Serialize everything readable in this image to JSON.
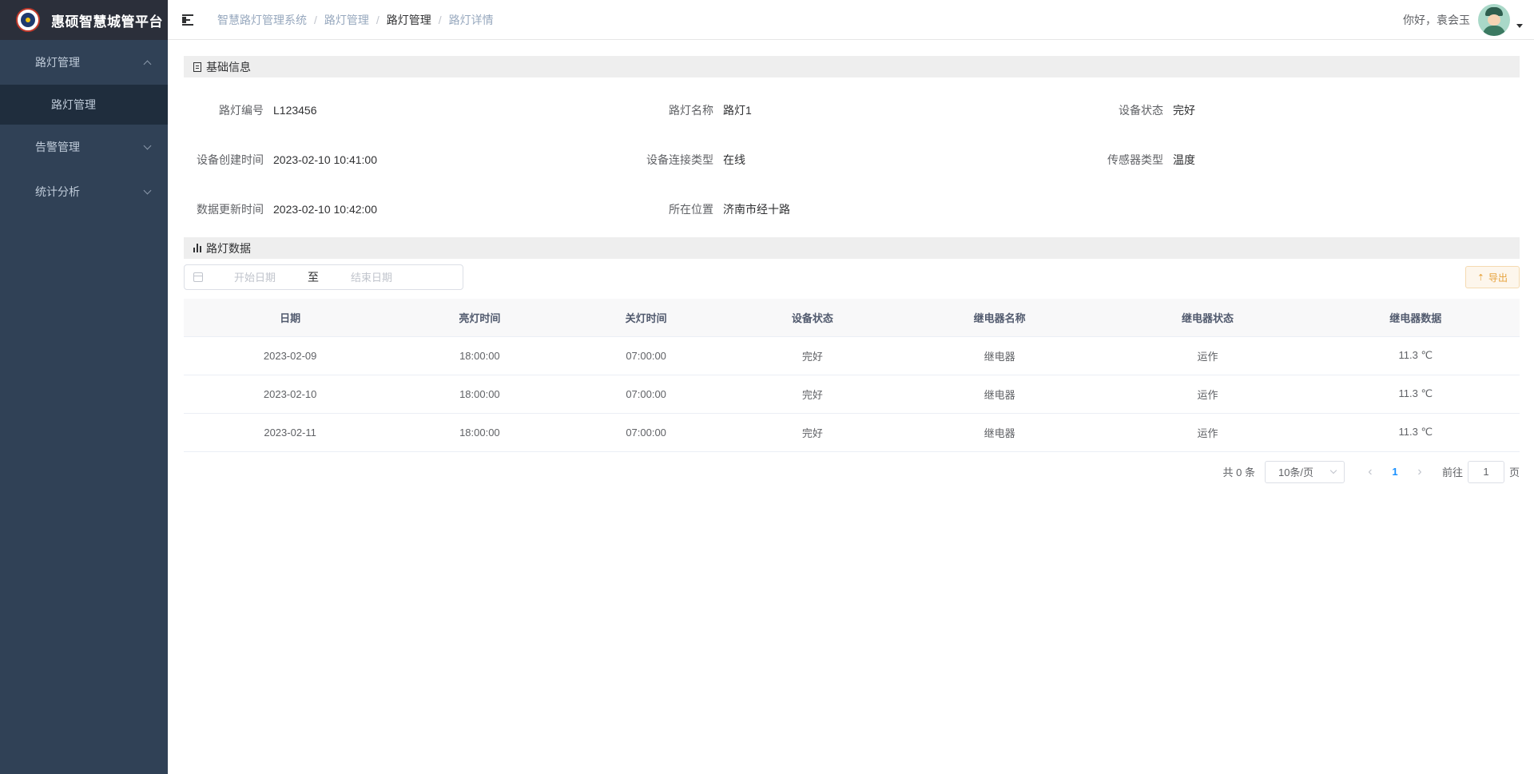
{
  "app": {
    "title": "惠硕智慧城管平台"
  },
  "sidebar": {
    "items": [
      {
        "label": "路灯管理",
        "expanded": true,
        "children": [
          {
            "label": "路灯管理"
          }
        ]
      },
      {
        "label": "告警管理",
        "expanded": false
      },
      {
        "label": "统计分析",
        "expanded": false
      }
    ]
  },
  "header": {
    "breadcrumb": [
      "智慧路灯管理系统",
      "路灯管理",
      "路灯管理",
      "路灯详情"
    ],
    "greeting": "你好，袁会玉"
  },
  "basic_info": {
    "title": "基础信息",
    "fields": [
      {
        "label": "路灯编号",
        "value": "L123456"
      },
      {
        "label": "路灯名称",
        "value": "路灯1"
      },
      {
        "label": "设备状态",
        "value": "完好"
      },
      {
        "label": "设备创建时间",
        "value": "2023-02-10 10:41:00"
      },
      {
        "label": "设备连接类型",
        "value": "在线"
      },
      {
        "label": "传感器类型",
        "value": "温度"
      },
      {
        "label": "数据更新时间",
        "value": "2023-02-10 10:42:00"
      },
      {
        "label": "所在位置",
        "value": "济南市经十路"
      }
    ]
  },
  "light_data": {
    "title": "路灯数据",
    "date_range": {
      "start_placeholder": "开始日期",
      "separator": "至",
      "end_placeholder": "结束日期"
    },
    "export_label": "导出",
    "columns": [
      "日期",
      "亮灯时间",
      "关灯时间",
      "设备状态",
      "继电器名称",
      "继电器状态",
      "继电器数据"
    ],
    "rows": [
      [
        "2023-02-09",
        "18:00:00",
        "07:00:00",
        "完好",
        "继电器",
        "运作",
        "11.3 ℃"
      ],
      [
        "2023-02-10",
        "18:00:00",
        "07:00:00",
        "完好",
        "继电器",
        "运作",
        "11.3 ℃"
      ],
      [
        "2023-02-11",
        "18:00:00",
        "07:00:00",
        "完好",
        "继电器",
        "运作",
        "11.3 ℃"
      ]
    ]
  },
  "pagination": {
    "total": "共 0 条",
    "page_size": "10条/页",
    "current": "1",
    "goto_prefix": "前往",
    "goto_value": "1",
    "goto_suffix": "页"
  }
}
